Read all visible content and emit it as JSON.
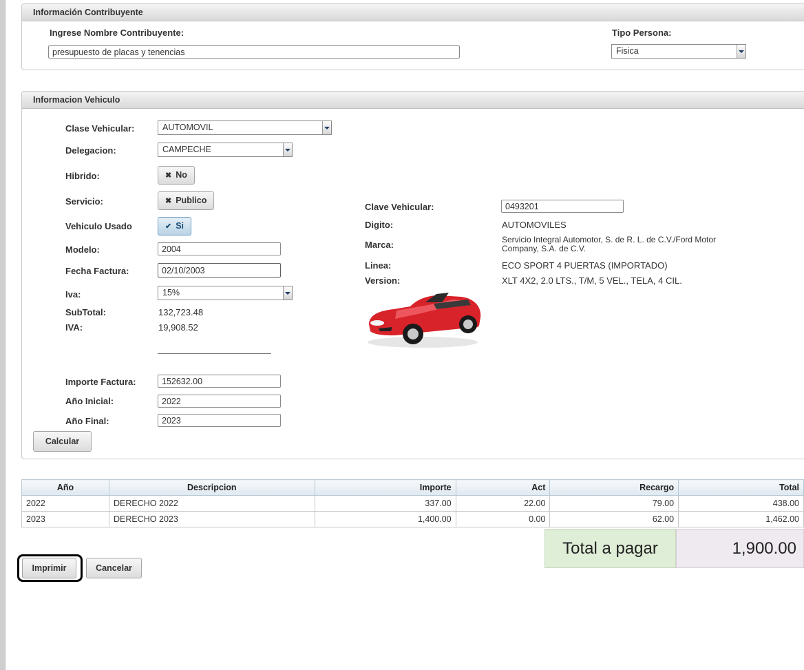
{
  "contribuyente": {
    "header": "Información Contribuyente",
    "nombre_label": "Ingrese Nombre Contribuyente:",
    "nombre_value": "presupuesto de placas y tenencias",
    "tipo_label": "Tipo Persona:",
    "tipo_value": "Fisica"
  },
  "vehiculo": {
    "header": "Informacion Vehiculo",
    "clase_label": "Clase Vehicular:",
    "clase_value": "AUTOMOVIL",
    "delegacion_label": "Delegacion:",
    "delegacion_value": "CAMPECHE",
    "hibrido_label": "Hibrido:",
    "hibrido_value": "No",
    "servicio_label": "Servicio:",
    "servicio_value": "Publico",
    "usado_label": "Vehiculo Usado",
    "usado_value": "Si",
    "modelo_label": "Modelo:",
    "modelo_value": "2004",
    "fecha_label": "Fecha Factura:",
    "fecha_value": "02/10/2003",
    "iva_label": "Iva:",
    "iva_value": "15%",
    "subtotal_label": "SubTotal:",
    "subtotal_value": "132,723.48",
    "iva_amount_label": "IVA:",
    "iva_amount_value": "19,908.52",
    "importe_label": "Importe Factura:",
    "importe_value": "152632.00",
    "anio_inicial_label": "Año Inicial:",
    "anio_inicial_value": "2022",
    "anio_final_label": "Año Final:",
    "anio_final_value": "2023",
    "calcular_label": "Calcular",
    "clave_label": "Clave Vehicular:",
    "clave_value": "0493201",
    "digito_label": "Digito:",
    "digito_value": "AUTOMOVILES",
    "marca_label": "Marca:",
    "marca_line1": "Servicio Integral Automotor, S. de R. L. de C.V./Ford Motor",
    "marca_line2": "Company, S.A. de C.V.",
    "linea_label": "Linea:",
    "linea_value": "ECO SPORT 4 PUERTAS (IMPORTADO)",
    "version_label": "Version:",
    "version_value": "XLT 4X2, 2.0 LTS., T/M, 5 VEL., TELA, 4 CIL.",
    "car_color": "#d8232a"
  },
  "tabla": {
    "headers": [
      "Año",
      "Descripcion",
      "Importe",
      "Act",
      "Recargo",
      "Total"
    ],
    "rows": [
      [
        "2022",
        "DERECHO 2022",
        "337.00",
        "22.00",
        "79.00",
        "438.00"
      ],
      [
        "2023",
        "DERECHO 2023",
        "1,400.00",
        "0.00",
        "62.00",
        "1,462.00"
      ]
    ]
  },
  "total": {
    "label": "Total a pagar",
    "value": "1,900.00"
  },
  "acciones": {
    "imprimir": "Imprimir",
    "cancelar": "Cancelar"
  }
}
